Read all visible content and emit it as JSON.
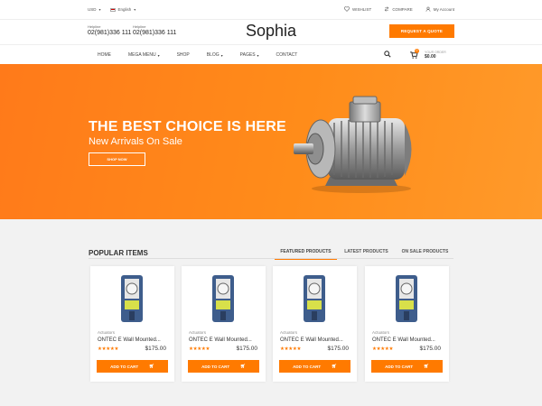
{
  "topbar": {
    "currency": "USD",
    "language": "English",
    "wishlist": "WISHLIST",
    "compare": "COMPARE",
    "account": "My Account"
  },
  "header": {
    "helplines": [
      {
        "label": "Helpline",
        "number": "02(981)336 111"
      },
      {
        "label": "Helpline",
        "number": "02(981)336 111"
      }
    ],
    "logo": "Sophia",
    "quote_button": "REQUEST A QUOTE"
  },
  "nav": {
    "items": [
      {
        "label": "HOME",
        "dropdown": false
      },
      {
        "label": "MEGA MENU",
        "dropdown": true
      },
      {
        "label": "SHOP",
        "dropdown": false
      },
      {
        "label": "BLOG",
        "dropdown": true
      },
      {
        "label": "PAGES",
        "dropdown": true
      },
      {
        "label": "CONTACT",
        "dropdown": false
      }
    ],
    "cart": {
      "count": "0",
      "label": "YOUR ORDER",
      "total": "$0.00"
    }
  },
  "hero": {
    "headline": "THE BEST CHOICE IS HERE",
    "subheadline": "New Arrivals On Sale",
    "button": "SHOP NOW"
  },
  "products": {
    "title": "POPULAR ITEMS",
    "tabs": [
      "FEATURED PRODUCTS",
      "LATEST PRODUCTS",
      "ON SALE PRODUCTS"
    ],
    "active_tab": 0,
    "items": [
      {
        "category": "Actuators",
        "name": "ONTEC E Wall Mounted...",
        "rating": 5,
        "price": "$175.00",
        "button": "ADD TO CART"
      },
      {
        "category": "Actuators",
        "name": "ONTEC E Wall Mounted...",
        "rating": 5,
        "price": "$175.00",
        "button": "ADD TO CART"
      },
      {
        "category": "Actuators",
        "name": "ONTEC E Wall Mounted...",
        "rating": 5,
        "price": "$175.00",
        "button": "ADD TO CART"
      },
      {
        "category": "Actuators",
        "name": "ONTEC E Wall Mounted...",
        "rating": 5,
        "price": "$175.00",
        "button": "ADD TO CART"
      }
    ]
  },
  "colors": {
    "accent": "#ff7a00",
    "hero_bg": "#ff8c1a",
    "section_bg": "#f2f2f2"
  }
}
